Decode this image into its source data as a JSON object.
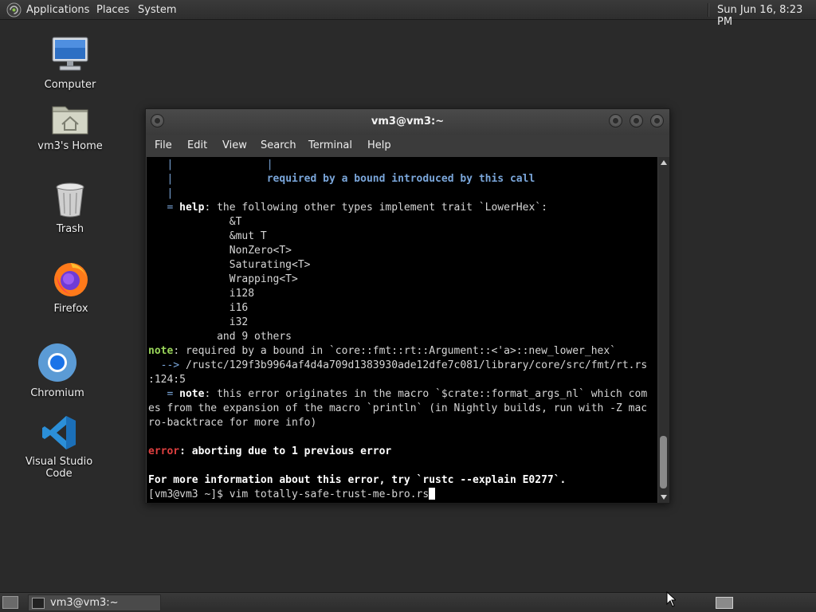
{
  "top_panel": {
    "menus": [
      "Applications",
      "Places",
      "System"
    ],
    "clock": "Sun Jun 16,  8:23 PM"
  },
  "desktop": {
    "icons": [
      {
        "label": "Computer",
        "icon": "computer-icon"
      },
      {
        "label": "vm3's Home",
        "icon": "home-folder-icon"
      },
      {
        "label": "Trash",
        "icon": "trash-icon"
      },
      {
        "label": "Firefox",
        "icon": "firefox-icon"
      },
      {
        "label": "Chromium",
        "icon": "chromium-icon"
      },
      {
        "label": "Visual Studio Code",
        "icon": "vscode-icon"
      }
    ]
  },
  "terminal": {
    "title": "vm3@vm3:~",
    "menu": [
      "File",
      "Edit",
      "View",
      "Search",
      "Terminal",
      "Help"
    ],
    "lines": {
      "l1": "   |               |",
      "l2a": "   |               ",
      "l2b": "required by a bound introduced by this call",
      "l3": "   |",
      "l4a": "   = ",
      "l4b": "help",
      "l4c": ": the following other types implement trait `LowerHex`:",
      "l5": "             &T",
      "l6": "             &mut T",
      "l7": "             NonZero<T>",
      "l8": "             Saturating<T>",
      "l9": "             Wrapping<T>",
      "l10": "             i128",
      "l11": "             i16",
      "l12": "             i32",
      "l13": "           and 9 others",
      "l14a": "note",
      "l14b": ": required by a bound in `core::fmt::rt::Argument::<'a>::new_lower_hex`",
      "l15a": "  --> ",
      "l15b": "/rustc/129f3b9964af4d4a709d1383930ade12dfe7c081/library/core/src/fmt/rt.rs",
      "l16": ":124:5",
      "l17a": "   = ",
      "l17b": "note",
      "l17c": ": this error originates in the macro `$crate::format_args_nl` which com",
      "l18": "es from the expansion of the macro `println` (in Nightly builds, run with -Z mac",
      "l19": "ro-backtrace for more info)",
      "l20a": "error",
      "l20b": ": aborting due to 1 previous error",
      "l21": "For more information about this error, try `rustc --explain E0277`.",
      "prompt": "[vm3@vm3 ~]$ vim totally-safe-trust-me-bro.rs"
    }
  },
  "taskbar": {
    "task": "vm3@vm3:~"
  },
  "colors": {
    "note_green": "#9ad65a",
    "error_red": "#e04040",
    "help_blue": "#7aa6da"
  }
}
